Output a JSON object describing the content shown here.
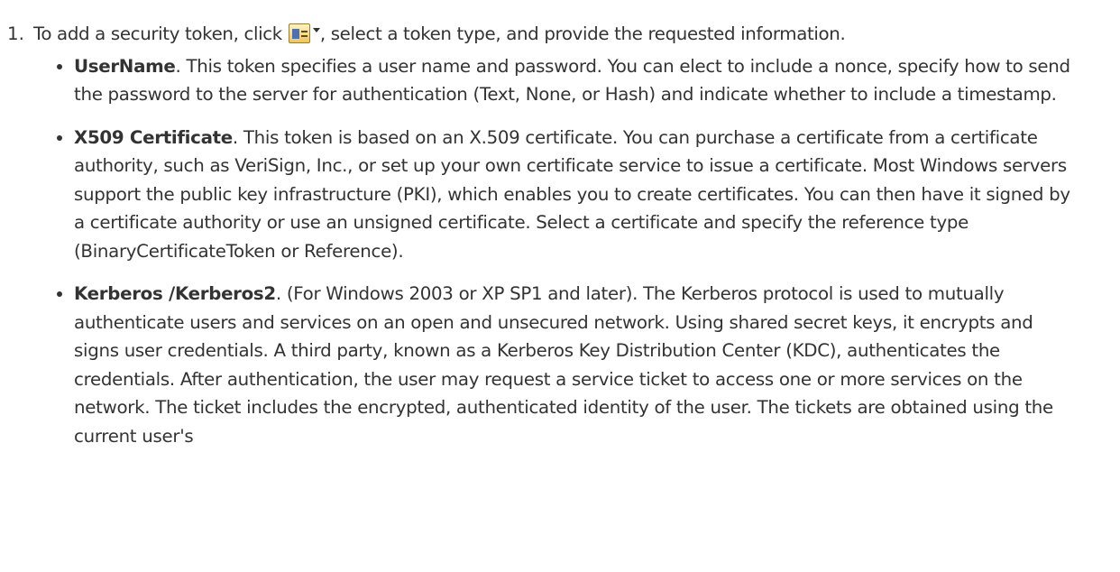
{
  "step": {
    "number": "1.",
    "text_before_icon": "To add a security token, click ",
    "icon": "add-token-dropdown-icon",
    "text_after_icon": ", select a token type, and provide the requested information."
  },
  "token_types": [
    {
      "term": "UserName",
      "description": ". This token specifies a user name and password. You can elect to include a nonce, specify how to send the password to the server for authentication (Text, None, or Hash) and indicate whether to include a timestamp."
    },
    {
      "term": "X509 Certificate",
      "description": ". This token is based on an X.509 certificate. You can purchase a certificate from a certificate authority, such as VeriSign, Inc., or set up your own certificate service to issue a certificate. Most Windows servers support the public key infrastructure (PKI), which enables you to create certificates. You can then have it signed by a certificate authority or use an unsigned certificate. Select a certificate and specify the reference type (BinaryCertificateToken or Reference)."
    },
    {
      "term": "Kerberos /Kerberos2",
      "description": ". (For Windows 2003 or XP SP1 and later). The Kerberos protocol is used to mutually authenticate users and services on an open and unsecured network. Using shared secret keys, it encrypts and signs user credentials. A third party, known as a Kerberos Key Distribution Center (KDC), authenticates the credentials. After authentication, the user may request a service ticket to access one or more services on the network. The ticket includes the encrypted, authenticated identity of the user. The tickets are obtained using the current user's"
    }
  ],
  "colors": {
    "text": "#333333",
    "background": "#ffffff"
  }
}
